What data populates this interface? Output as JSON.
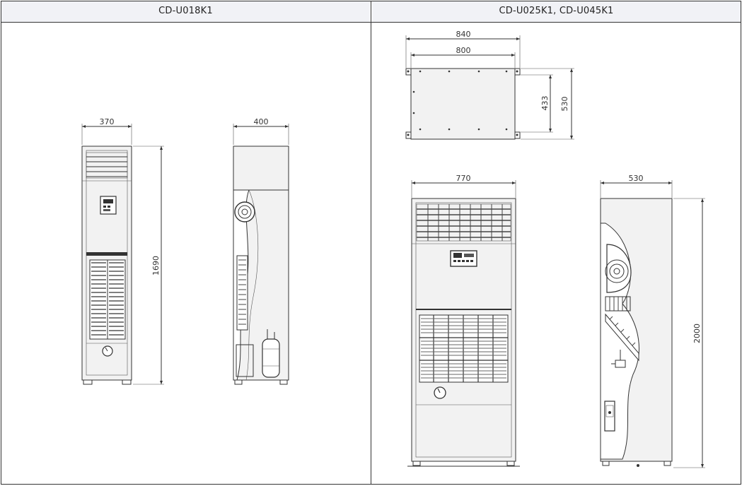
{
  "table": {
    "left_header": "CD-U018K1",
    "right_header": "CD-U025K1, CD-U045K1"
  },
  "dimensions": {
    "u018_front_width": "370",
    "u018_side_depth": "400",
    "u018_height": "1690",
    "top_outer_width": "840",
    "top_inner_width": "800",
    "top_inner_depth": "433",
    "top_outer_depth": "530",
    "large_front_width": "770",
    "large_side_depth": "530",
    "large_height": "2000"
  }
}
